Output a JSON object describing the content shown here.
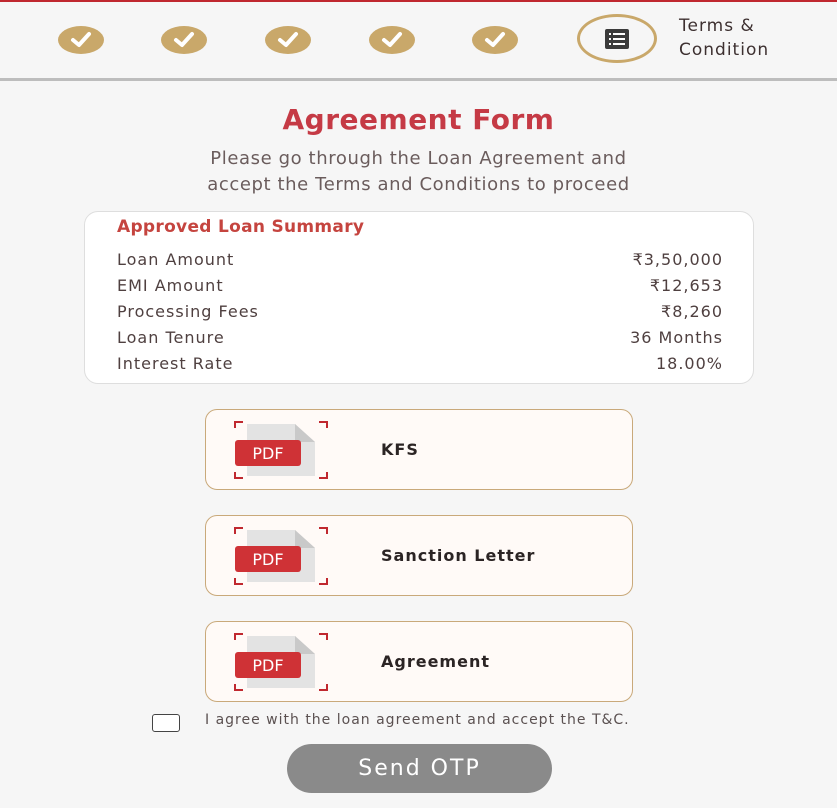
{
  "colors": {
    "accent": "#c53a45",
    "step_complete": "#c9a86a",
    "button_disabled": "#8a8a8a"
  },
  "stepper": {
    "completed_steps": [
      "check-icon",
      "check-icon",
      "check-icon",
      "check-icon",
      "check-icon"
    ],
    "active_step_icon": "list-icon",
    "active_step_label_line1": "Terms &",
    "active_step_label_line2": "Condition"
  },
  "header": {
    "title": "Agreement Form",
    "subtitle_line1": "Please go through the Loan Agreement and",
    "subtitle_line2": "accept the Terms and Conditions to proceed"
  },
  "summary": {
    "title": "Approved Loan Summary",
    "rows": [
      {
        "label": "Loan Amount",
        "value": "₹3,50,000"
      },
      {
        "label": "EMI Amount",
        "value": "₹12,653"
      },
      {
        "label": "Processing Fees",
        "value": "₹8,260"
      },
      {
        "label": "Loan Tenure",
        "value": "36 Months"
      },
      {
        "label": "Interest Rate",
        "value": "18.00%"
      }
    ]
  },
  "documents": [
    {
      "icon": "pdf-icon",
      "badge": "PDF",
      "label": "KFS"
    },
    {
      "icon": "pdf-icon",
      "badge": "PDF",
      "label": "Sanction Letter"
    },
    {
      "icon": "pdf-icon",
      "badge": "PDF",
      "label": "Agreement"
    }
  ],
  "consent": {
    "checked": false,
    "text": "I agree with the loan agreement and accept the T&C."
  },
  "actions": {
    "send_otp_label": "Send OTP"
  }
}
